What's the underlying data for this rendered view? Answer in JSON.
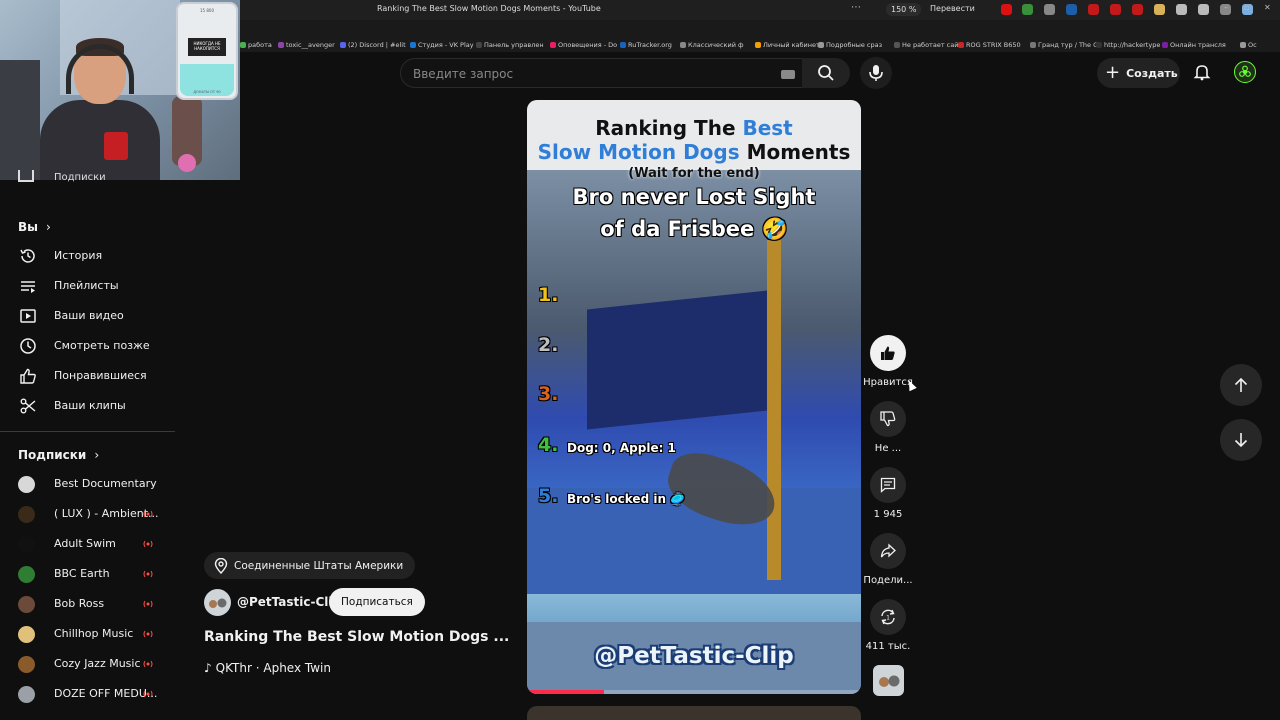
{
  "browser": {
    "tab_title": "Ranking The Best Slow Motion Dogs Moments - YouTube",
    "zoom": "150 %",
    "translate_label": "Перевести",
    "bookmarks": [
      "работа",
      "toxic__avenger",
      "(2) Discord | #elit",
      "Студия - VK Play",
      "Панель управлен",
      "Оповещения - Do",
      "RuTracker.org",
      "Классический ф",
      "Личный кабинет",
      "Подробные сраз",
      "Не работает сайт",
      "ROG STRIX B650",
      "Гранд тур / The G",
      "http://hackertype",
      "Онлайн трансля",
      "Ос"
    ]
  },
  "webcam": {
    "phone_top": "15 800",
    "phone_screen": "НИКОГДА НЕ НАКОПИТСЯ",
    "phone_bottom": "ДОНАТЫ ОТ 90"
  },
  "topbar": {
    "search_placeholder": "Введите запрос",
    "create_label": "Создать"
  },
  "sidebar": {
    "cut_item": "Подписки",
    "you_header": "Вы",
    "you_items": [
      {
        "icon": "history-icon",
        "label": "История"
      },
      {
        "icon": "playlists-icon",
        "label": "Плейлисты"
      },
      {
        "icon": "your-videos-icon",
        "label": "Ваши видео"
      },
      {
        "icon": "watch-later-icon",
        "label": "Смотреть позже"
      },
      {
        "icon": "liked-icon",
        "label": "Понравившиеся"
      },
      {
        "icon": "clips-icon",
        "label": "Ваши клипы"
      }
    ],
    "subs_header": "Подписки",
    "subscriptions": [
      {
        "label": "Best Documentary",
        "color": "#d8d8d8",
        "live": false
      },
      {
        "label": "( LUX ) - Ambient...",
        "color": "#3a2a1a",
        "live": true
      },
      {
        "label": "Adult Swim",
        "color": "#111111",
        "live": true
      },
      {
        "label": "BBC Earth",
        "color": "#2e7d32",
        "live": true
      },
      {
        "label": "Bob Ross",
        "color": "#6b4a3a",
        "live": true
      },
      {
        "label": "Chillhop Music",
        "color": "#e0c07a",
        "live": true
      },
      {
        "label": "Cozy Jazz Music",
        "color": "#8a5a2a",
        "live": true
      },
      {
        "label": "DOZE OFF MEDU...",
        "color": "#9aa0a6",
        "live": true
      }
    ]
  },
  "short": {
    "location": "Соединенные Штаты Америки",
    "channel": "@PetTastic-Clip",
    "subscribe_label": "Подписаться",
    "title": "Ranking The Best Slow Motion Dogs ...",
    "music": "QKThr · Aphex Twin",
    "progress": 0.23
  },
  "video": {
    "title_line1_a": "Ranking The ",
    "title_line1_b": "Best",
    "title_line2_a": "Slow Motion Dogs",
    "title_line2_b": " Moments",
    "subtitle": "(Wait for the end)",
    "caption_line1": "Bro never Lost Sight",
    "caption_line2": "of da Frisbee 🤣",
    "ranks": [
      {
        "num": "1.",
        "color": "#f2c21a",
        "text": ""
      },
      {
        "num": "2.",
        "color": "#bfbfbf",
        "text": ""
      },
      {
        "num": "3.",
        "color": "#d9621e",
        "text": ""
      },
      {
        "num": "4.",
        "color": "#3fbf3f",
        "text": "Dog: 0, Apple: 1"
      },
      {
        "num": "5.",
        "color": "#2f7ed8",
        "text": "Bro's locked in 🥏"
      }
    ],
    "handle": "@PetTastic-Clip"
  },
  "actions": {
    "like": "Нравится",
    "dislike": "Не ...",
    "comments": "1 945",
    "share": "Подели...",
    "remix": "411 тыс."
  }
}
